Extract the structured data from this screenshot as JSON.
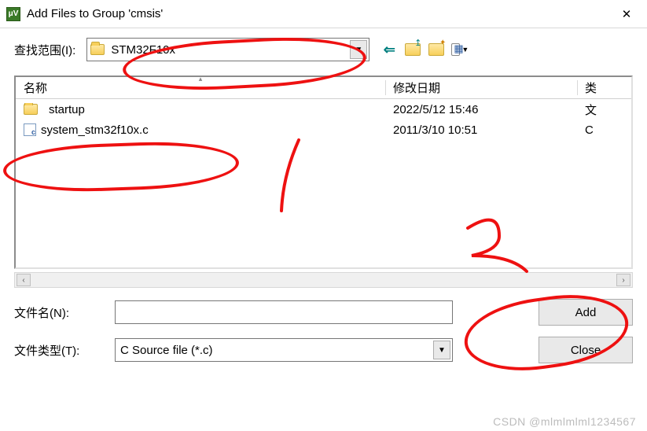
{
  "window": {
    "title": "Add Files to Group 'cmsis'",
    "app_icon_text": "μV"
  },
  "lookin": {
    "label": "查找范围(I):",
    "value": "STM32F10x"
  },
  "columns": {
    "name": "名称",
    "date": "修改日期",
    "type": "类"
  },
  "rows": [
    {
      "icon": "folder",
      "name": "startup",
      "date": "2022/5/12 15:46",
      "type": "文"
    },
    {
      "icon": "cfile",
      "name": "system_stm32f10x.c",
      "date": "2011/3/10 10:51",
      "type": "C "
    }
  ],
  "filename": {
    "label": "文件名(N):",
    "value": ""
  },
  "filetype": {
    "label": "文件类型(T):",
    "value": "C Source file (*.c)"
  },
  "buttons": {
    "add": "Add",
    "close": "Close"
  },
  "annotations": {
    "mark1": "1",
    "mark2": "2"
  },
  "watermark": "CSDN @mlmlmlml1234567"
}
